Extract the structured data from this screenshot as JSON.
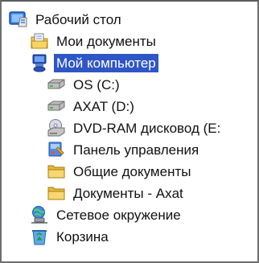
{
  "colors": {
    "selection": "#2f56c6",
    "selection_text": "#ffffff",
    "text": "#111111",
    "folder": "#f2c94a",
    "border": "#6f6f6f"
  },
  "tree": {
    "items": [
      {
        "id": "desktop",
        "label": "Рабочий стол",
        "icon": "desktop-icon",
        "level": 0,
        "selected": false
      },
      {
        "id": "my-docs",
        "label": "Мои документы",
        "icon": "my-documents-icon",
        "level": 1,
        "selected": false
      },
      {
        "id": "my-computer",
        "label": "Мой компьютер",
        "icon": "my-computer-icon",
        "level": 1,
        "selected": true
      },
      {
        "id": "drive-c",
        "label": "OS (C:)",
        "icon": "hard-drive-icon",
        "level": 2,
        "selected": false
      },
      {
        "id": "drive-d",
        "label": "AXAT (D:)",
        "icon": "hard-drive-icon",
        "level": 2,
        "selected": false
      },
      {
        "id": "dvd",
        "label": "DVD-RAM дисковод (E:",
        "icon": "dvd-drive-icon",
        "level": 2,
        "selected": false
      },
      {
        "id": "control-panel",
        "label": "Панель управления",
        "icon": "control-panel-icon",
        "level": 2,
        "selected": false
      },
      {
        "id": "shared-docs",
        "label": "Общие документы",
        "icon": "folder-icon",
        "level": 2,
        "selected": false
      },
      {
        "id": "axat-docs",
        "label": "Документы - Axat",
        "icon": "folder-icon",
        "level": 2,
        "selected": false
      },
      {
        "id": "network",
        "label": "Сетевое окружение",
        "icon": "network-places-icon",
        "level": 1,
        "selected": false
      },
      {
        "id": "recycle",
        "label": "Корзина",
        "icon": "recycle-bin-icon",
        "level": 1,
        "selected": false
      }
    ]
  }
}
